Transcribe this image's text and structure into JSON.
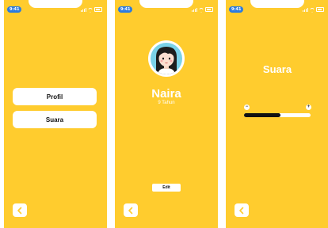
{
  "status_time": "9:41",
  "screen_menu": {
    "buttons": [
      {
        "label": "Profil"
      },
      {
        "label": "Suara"
      }
    ]
  },
  "screen_profile": {
    "name": "Naira",
    "age": "9 Tahun",
    "edit_label": "Edit"
  },
  "screen_sound": {
    "title": "Suara",
    "minus": "−",
    "plus": "+",
    "volume": 0.55
  },
  "icons": {
    "back": "chevron-left-icon",
    "avatar": "girl-avatar-icon"
  },
  "colors": {
    "background": "#FFCC2E",
    "button": "#FFFFFF",
    "time_badge": "#2B7BE0",
    "slider_fill": "#111111"
  }
}
